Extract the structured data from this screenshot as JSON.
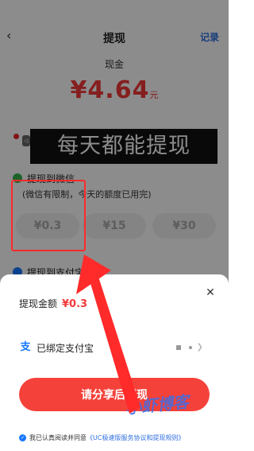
{
  "app": {
    "page_title": "提现",
    "records_link": "记录"
  },
  "balance": {
    "label": "现金",
    "amount": "¥4.64",
    "unit": "元"
  },
  "overlay_banner": "每天都能提现",
  "wechat_section": {
    "label": "提现到微信",
    "limit_note": "(微信有限制，今天的额度已用完)",
    "options": [
      "¥0.3",
      "¥15",
      "¥30"
    ]
  },
  "alipay_section": {
    "label": "提现到支付宝"
  },
  "sheet": {
    "withdraw_label": "提现金额",
    "withdraw_value": "¥0.3",
    "bind_text": "已绑定支付宝",
    "cta_label": "请分享后提现",
    "agree_prefix": "我已认真阅读并同意",
    "agree_link": "《UC极速版服务协议和提现规则》"
  },
  "watermark": "小虾博客",
  "colors": {
    "accent_red": "#f23a3a",
    "link_blue": "#2f6fe0",
    "wechat_green": "#34b24d",
    "alipay_blue": "#1677ff",
    "annotation_red": "#ff2a2a"
  },
  "icons": [
    "back-icon",
    "wechat-icon",
    "alipay-icon",
    "close-icon",
    "chevron-right-icon",
    "check-icon"
  ]
}
